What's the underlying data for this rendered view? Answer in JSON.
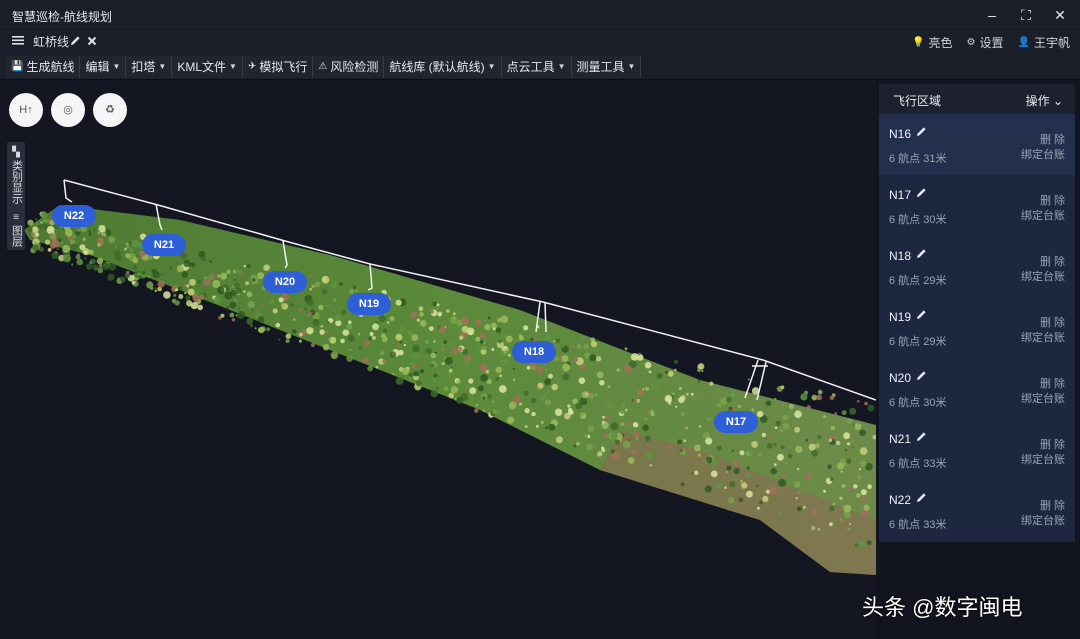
{
  "window": {
    "title": "智慧巡检-航线规划",
    "min_glyph": "–",
    "max_glyph": "⛶",
    "close_glyph": "✕"
  },
  "docbar": {
    "route_name": "虹桥线",
    "right_ops": [
      {
        "icon": "bulb-icon",
        "glyph": "💡",
        "label": "亮色"
      },
      {
        "icon": "gear-icon",
        "glyph": "⚙",
        "label": "设置"
      },
      {
        "icon": "user-icon",
        "glyph": "👤",
        "label": "王宇帆"
      }
    ]
  },
  "toolbar": [
    {
      "label": "生成航线",
      "icon": "save-icon",
      "glyph": "💾",
      "dropdown": false
    },
    {
      "label": "编辑",
      "dropdown": true
    },
    {
      "label": "扣塔",
      "dropdown": true
    },
    {
      "label": "KML文件",
      "dropdown": true
    },
    {
      "label": "模拟飞行",
      "icon": "plane-icon",
      "glyph": "✈",
      "dropdown": false
    },
    {
      "label": "风险检测",
      "icon": "warning-icon",
      "glyph": "⚠",
      "dropdown": false
    },
    {
      "label": "航线库 (默认航线)",
      "dropdown": true
    },
    {
      "label": "点云工具",
      "dropdown": true
    },
    {
      "label": "测量工具",
      "dropdown": true
    }
  ],
  "viewport": {
    "buttons": {
      "heading": "H↑",
      "orbit": "◎",
      "recycle": "♻"
    },
    "side_tabs": [
      {
        "icon": "category-icon",
        "glyph": "▚",
        "label": "类别显示"
      },
      {
        "icon": "layers-icon",
        "glyph": "≡",
        "label": "图层"
      }
    ],
    "towers": [
      "N22",
      "N21",
      "N20",
      "N19",
      "N18",
      "N17"
    ]
  },
  "panel": {
    "title": "飞行区域",
    "ops_label": "操作",
    "delete_label": "删 除",
    "bind_label": "绑定台账",
    "items": [
      {
        "name": "N16",
        "info": "6 航点 31米"
      },
      {
        "name": "N17",
        "info": "6 航点 30米"
      },
      {
        "name": "N18",
        "info": "6 航点 29米"
      },
      {
        "name": "N19",
        "info": "6 航点 29米"
      },
      {
        "name": "N20",
        "info": "6 航点 30米"
      },
      {
        "name": "N21",
        "info": "6 航点 33米"
      },
      {
        "name": "N22",
        "info": "6 航点 33米"
      }
    ]
  },
  "watermark": "头条 @数字闽电"
}
